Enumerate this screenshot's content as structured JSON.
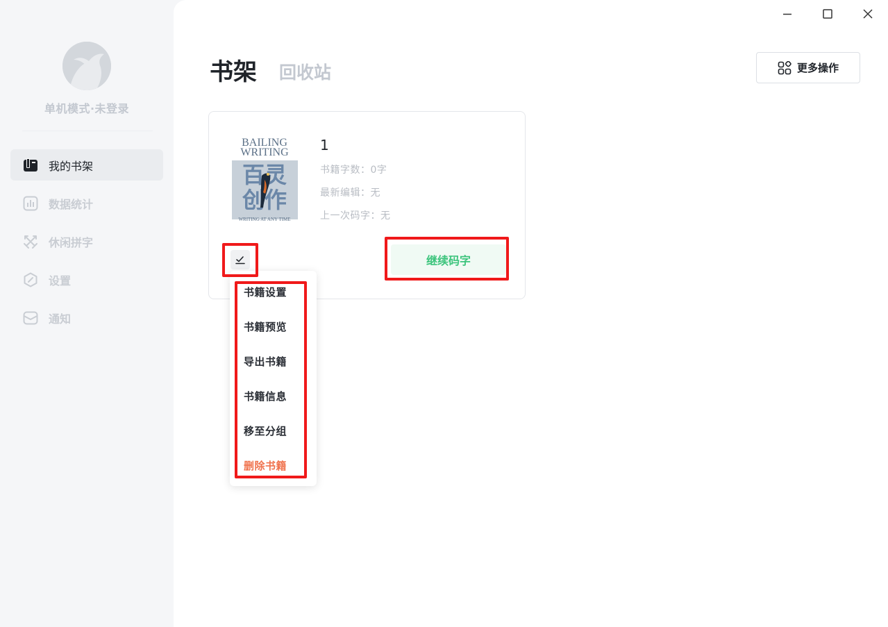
{
  "sidebar": {
    "user_status": "单机模式·未登录",
    "items": [
      {
        "label": "我的书架",
        "icon": "book-icon",
        "active": true
      },
      {
        "label": "数据统计",
        "icon": "chart-icon",
        "active": false
      },
      {
        "label": "休闲拼字",
        "icon": "swords-icon",
        "active": false
      },
      {
        "label": "设置",
        "icon": "settings-icon",
        "active": false
      },
      {
        "label": "通知",
        "icon": "mail-icon",
        "active": false
      }
    ]
  },
  "header": {
    "title": "书架",
    "recycle_tab": "回收站",
    "more_button": "更多操作"
  },
  "book": {
    "title": "1",
    "word_count": "书籍字数：0字",
    "last_edit": "最新编辑：无",
    "last_write": "上一次码字：无",
    "continue_button": "继续码字",
    "cover": {
      "line1": "BAILING",
      "line2": "WRITING",
      "cn_top": "百灵",
      "cn_bottom": "创作",
      "footer": "WRITING AT ANY TIME"
    }
  },
  "dropdown": {
    "items": [
      "书籍设置",
      "书籍预览",
      "导出书籍",
      "书籍信息",
      "移至分组",
      "删除书籍"
    ]
  },
  "colors": {
    "accent_green": "#3cc47c",
    "danger": "#f0734e",
    "highlight": "#f0191a"
  }
}
